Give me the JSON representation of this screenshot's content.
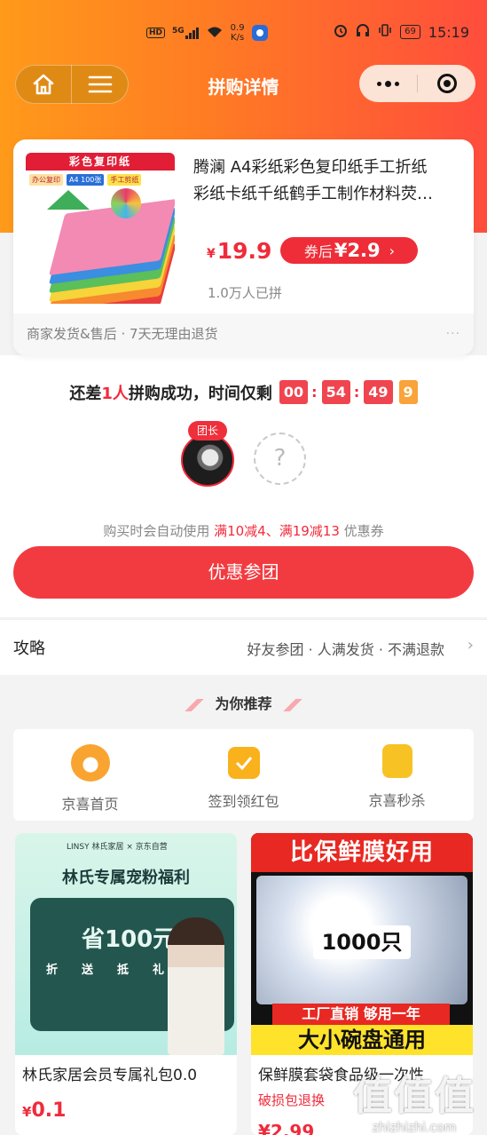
{
  "status_bar": {
    "network_hd": "HD",
    "network_gen": "5G",
    "speed_value": "0.9",
    "speed_unit": "K/s",
    "battery": "69",
    "time": "15:19"
  },
  "nav": {
    "title": "拼购详情"
  },
  "product": {
    "image_banner": "彩色复印纸",
    "image_tags": [
      "办公复印",
      "A4 100张",
      "手工剪纸"
    ],
    "title_line1": "腾澜 A4彩纸彩色复印纸手工折纸",
    "title_line2": "彩纸卡纸千纸鹤手工制作材料荧…",
    "currency": "¥",
    "price": "19.9",
    "coupon_label": "券后",
    "coupon_price": "¥2.9",
    "coupon_arrow": "›",
    "sold": "1.0万人已拼",
    "footer": "商家发货&售后 · 7天无理由退货",
    "footer_more": "···"
  },
  "group": {
    "prefix": "还差",
    "count": "1人",
    "middle": "拼购成功，时间仅剩",
    "hours": "00",
    "minutes": "54",
    "seconds": "49",
    "tenths": "9",
    "leader_tag": "团长",
    "empty_slot": "?"
  },
  "coupon_tip": {
    "prefix": "购买时会自动使用 ",
    "offers": "满10减4、满19减13",
    "suffix": " 优惠券"
  },
  "join_button": "优惠参团",
  "strategy": {
    "title": "攻略",
    "steps": "好友参团 · 人满发货 · 不满退款",
    "chevron": "›"
  },
  "recommend": {
    "title": "为你推荐",
    "quick_links": [
      {
        "label": "京喜首页",
        "icon": "cow-icon",
        "color": "#f9a431"
      },
      {
        "label": "签到领红包",
        "icon": "calendar-check-icon",
        "color": "#f9b21c"
      },
      {
        "label": "京喜秒杀",
        "icon": "shopping-bag-icon",
        "color": "#f7c224"
      }
    ]
  },
  "feed": [
    {
      "image_brand": "LINSY 林氏家居 × 京东自营",
      "image_headline": "林氏专属宠粉福利",
      "image_save": "省100元",
      "image_chips": [
        "折",
        "送",
        "抵",
        "礼"
      ],
      "name": "林氏家居会员专属礼包0.0",
      "currency": "¥",
      "price": "0.1"
    },
    {
      "image_top": "比保鲜膜好用",
      "image_qty": "1000只",
      "image_red": "工厂直销  够用一年",
      "image_yellow": "大小碗盘通用",
      "name": "保鲜膜套袋食品级一次性",
      "tag": "破损包退换",
      "price": "¥2.99"
    }
  ],
  "watermark": {
    "logo": "值值值",
    "url": "zhizhizhi.com"
  }
}
